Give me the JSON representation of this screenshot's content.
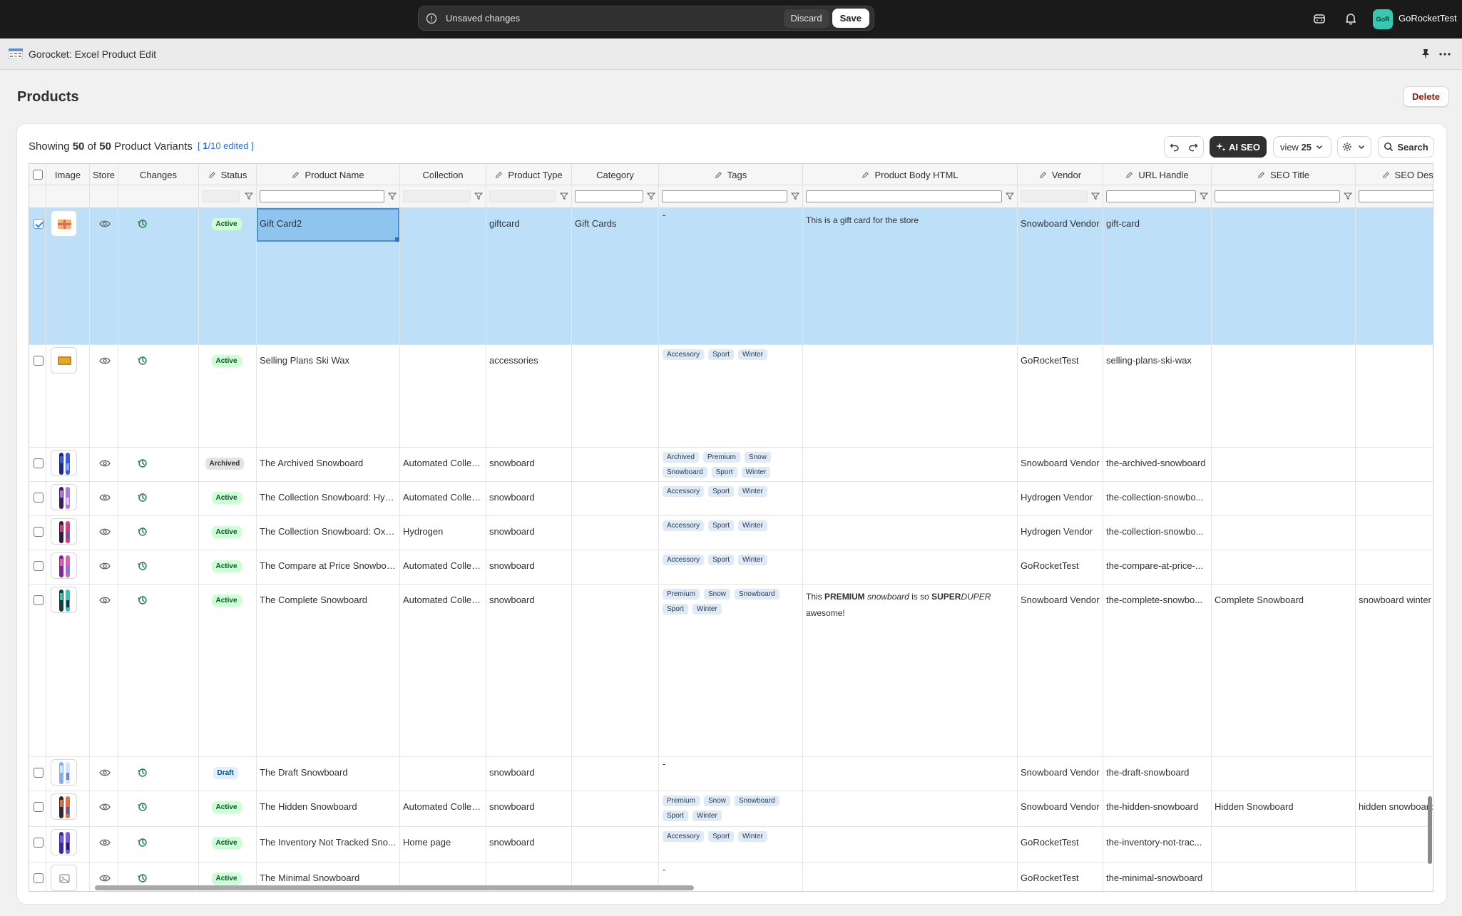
{
  "topbar": {
    "unsaved_text": "Unsaved changes",
    "discard_label": "Discard",
    "save_label": "Save",
    "store_avatar": "GoR",
    "store_name": "GoRocketTest"
  },
  "app": {
    "title": "Gorocket: Excel Product Edit"
  },
  "page": {
    "title": "Products",
    "delete_label": "Delete"
  },
  "summary": {
    "prefix": "Showing",
    "shown": "50",
    "of": "of",
    "total": "50",
    "suffix": "Product Variants",
    "edited_open": "[",
    "edited_count": "1",
    "edited_rest": "/10 edited ]"
  },
  "toolbar": {
    "ai_seo_label": "AI SEO",
    "view_prefix": "view",
    "view_value": "25",
    "search_label": "Search"
  },
  "columns": [
    {
      "key": "select",
      "label": ""
    },
    {
      "key": "image",
      "label": "Image"
    },
    {
      "key": "store",
      "label": "Store"
    },
    {
      "key": "changes",
      "label": "Changes"
    },
    {
      "key": "status",
      "label": "Status",
      "editable": true
    },
    {
      "key": "name",
      "label": "Product Name",
      "editable": true
    },
    {
      "key": "collection",
      "label": "Collection"
    },
    {
      "key": "type",
      "label": "Product Type",
      "editable": true
    },
    {
      "key": "category",
      "label": "Category"
    },
    {
      "key": "tags",
      "label": "Tags",
      "editable": true
    },
    {
      "key": "body",
      "label": "Product Body HTML",
      "editable": true
    },
    {
      "key": "vendor",
      "label": "Vendor",
      "editable": true
    },
    {
      "key": "handle",
      "label": "URL Handle",
      "editable": true
    },
    {
      "key": "seo_title",
      "label": "SEO Title",
      "editable": true
    },
    {
      "key": "seo_desc",
      "label": "SEO Descri",
      "editable": true
    }
  ],
  "rows": [
    {
      "checked": true,
      "image": "gift-card",
      "status": "Active",
      "name": "Gift Card2",
      "collection": "",
      "type": "giftcard",
      "category": "Gift Cards",
      "tags": [],
      "tags_dash": "-",
      "body": "This is a gift card for the store",
      "vendor": "Snowboard Vendor",
      "handle": "gift-card",
      "seo_title": "",
      "seo_desc": ""
    },
    {
      "checked": false,
      "image": "ski-wax",
      "status": "Active",
      "name": "Selling Plans Ski Wax",
      "collection": "",
      "type": "accessories",
      "category": "",
      "tags": [
        "Accessory",
        "Sport",
        "Winter"
      ],
      "body": "",
      "vendor": "GoRocketTest",
      "handle": "selling-plans-ski-wax",
      "seo_title": "",
      "seo_desc": ""
    },
    {
      "checked": false,
      "image": "snowboard-blue",
      "status": "Archived",
      "name": "The Archived Snowboard",
      "collection": "Automated Collec...",
      "type": "snowboard",
      "category": "",
      "tags": [
        "Archived",
        "Premium",
        "Snow",
        "Snowboard",
        "Sport",
        "Winter"
      ],
      "body": "",
      "vendor": "Snowboard Vendor",
      "handle": "the-archived-snowboard",
      "seo_title": "",
      "seo_desc": ""
    },
    {
      "checked": false,
      "image": "snowboard-purple",
      "status": "Active",
      "name": "The Collection Snowboard: Hyd...",
      "collection": "Automated Collec...",
      "type": "snowboard",
      "category": "",
      "tags": [
        "Accessory",
        "Sport",
        "Winter"
      ],
      "body": "",
      "vendor": "Hydrogen Vendor",
      "handle": "the-collection-snowbo...",
      "seo_title": "",
      "seo_desc": ""
    },
    {
      "checked": false,
      "image": "snowboard-red",
      "status": "Active",
      "name": "The Collection Snowboard: Oxy...",
      "collection": "Hydrogen",
      "type": "snowboard",
      "category": "",
      "tags": [
        "Accessory",
        "Sport",
        "Winter"
      ],
      "body": "",
      "vendor": "Hydrogen Vendor",
      "handle": "the-collection-snowbo...",
      "seo_title": "",
      "seo_desc": ""
    },
    {
      "checked": false,
      "image": "snowboard-pink",
      "status": "Active",
      "name": "The Compare at Price Snowboard",
      "collection": "Automated Collec...",
      "type": "snowboard",
      "category": "",
      "tags": [
        "Accessory",
        "Sport",
        "Winter"
      ],
      "body": "",
      "vendor": "GoRocketTest",
      "handle": "the-compare-at-price-...",
      "seo_title": "",
      "seo_desc": ""
    },
    {
      "checked": false,
      "image": "snowboard-teal",
      "status": "Active",
      "name": "The Complete Snowboard",
      "collection": "Automated Collec...",
      "type": "snowboard",
      "category": "",
      "tags": [
        "Premium",
        "Snow",
        "Snowboard",
        "Sport",
        "Winter"
      ],
      "body_rich": {
        "a": "This ",
        "b": "PREMIUM",
        "c": " ",
        "d": "snowboard",
        "e": " is so ",
        "f": "SUPER",
        "g": "DUPER",
        "h": " awesome!"
      },
      "vendor": "Snowboard Vendor",
      "handle": "the-complete-snowbo...",
      "seo_title": "Complete Snowboard",
      "seo_desc": "snowboard winter sport"
    },
    {
      "checked": false,
      "image": "snowboard-light",
      "status": "Draft",
      "name": "The Draft Snowboard",
      "collection": "",
      "type": "snowboard",
      "category": "",
      "tags": [],
      "tags_dash": "-",
      "body": "",
      "vendor": "Snowboard Vendor",
      "handle": "the-draft-snowboard",
      "seo_title": "",
      "seo_desc": ""
    },
    {
      "checked": false,
      "image": "snowboard-dark",
      "status": "Active",
      "name": "The Hidden Snowboard",
      "collection": "Automated Collec...",
      "type": "snowboard",
      "category": "",
      "tags": [
        "Premium",
        "Snow",
        "Snowboard",
        "Sport",
        "Winter"
      ],
      "body": "",
      "vendor": "Snowboard Vendor",
      "handle": "the-hidden-snowboard",
      "seo_title": "Hidden Snowboard",
      "seo_desc": "hidden snowboard wint"
    },
    {
      "checked": false,
      "image": "snowboard-violet",
      "status": "Active",
      "name": "The Inventory Not Tracked Sno...",
      "collection": "Home page",
      "type": "snowboard",
      "category": "",
      "tags": [
        "Accessory",
        "Sport",
        "Winter"
      ],
      "body": "",
      "vendor": "GoRocketTest",
      "handle": "the-inventory-not-trac...",
      "seo_title": "",
      "seo_desc": ""
    },
    {
      "checked": false,
      "image": "placeholder",
      "status": "Active",
      "name": "The Minimal Snowboard",
      "collection": "",
      "type": "",
      "category": "",
      "tags": [],
      "tags_dash": "-",
      "body": "",
      "vendor": "GoRocketTest",
      "handle": "the-minimal-snowboard",
      "seo_title": "",
      "seo_desc": ""
    }
  ]
}
